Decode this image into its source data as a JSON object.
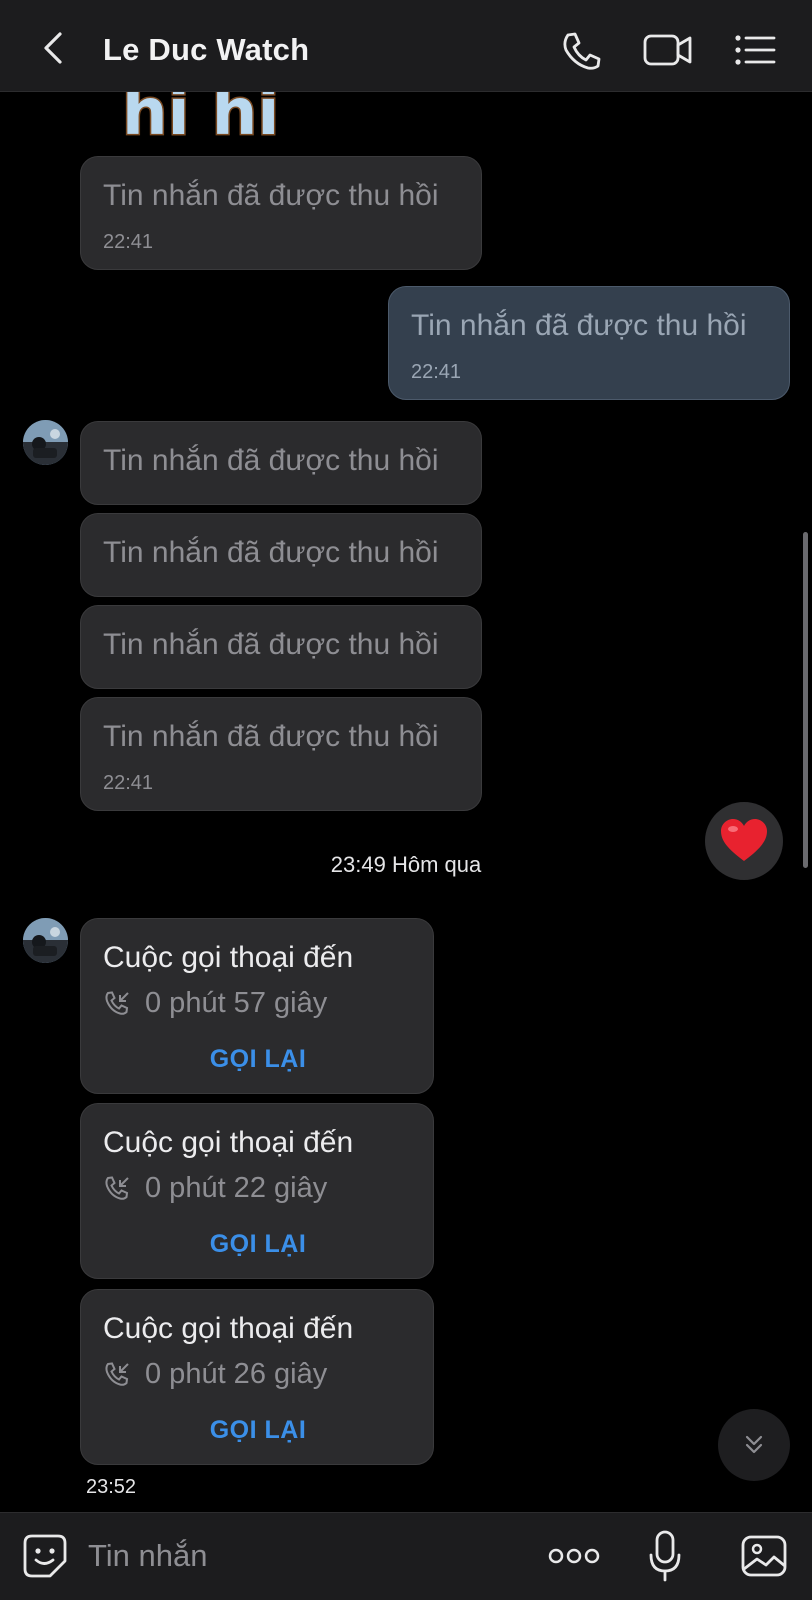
{
  "header": {
    "title": "Le Duc Watch"
  },
  "sticker": {
    "text": "hi hi"
  },
  "messages": [
    {
      "text": "Tin nhắn đã được thu hồi",
      "time": "22:41"
    },
    {
      "text": "Tin nhắn đã được thu hồi",
      "time": "22:41"
    },
    {
      "text": "Tin nhắn đã được thu hồi"
    },
    {
      "text": "Tin nhắn đã được thu hồi"
    },
    {
      "text": "Tin nhắn đã được thu hồi"
    },
    {
      "text": "Tin nhắn đã được thu hồi",
      "time": "22:41"
    }
  ],
  "day_separator": "23:49 Hôm qua",
  "calls": [
    {
      "title": "Cuộc gọi thoại đến",
      "duration": "0 phút 57 giây",
      "action": "GỌI LẠI"
    },
    {
      "title": "Cuộc gọi thoại đến",
      "duration": "0 phút 22 giây",
      "action": "GỌI LẠI"
    },
    {
      "title": "Cuộc gọi thoại đến",
      "duration": "0 phút 26 giây",
      "action": "GỌI LẠI"
    }
  ],
  "last_time": "23:52",
  "reaction": "heart-icon",
  "input": {
    "placeholder": "Tin nhắn"
  },
  "icons": {
    "back": "chevron-left-icon",
    "call": "phone-icon",
    "video": "video-camera-icon",
    "menu": "list-icon",
    "sticker": "smiley-sticker-icon",
    "more": "more-dots-icon",
    "mic": "microphone-icon",
    "image": "image-icon",
    "scroll_down": "double-chevron-down-icon"
  },
  "colors": {
    "background": "#000000",
    "bubble": "#2b2b2d",
    "bubble_out": "#34404e",
    "accent": "#3b8fe8"
  }
}
